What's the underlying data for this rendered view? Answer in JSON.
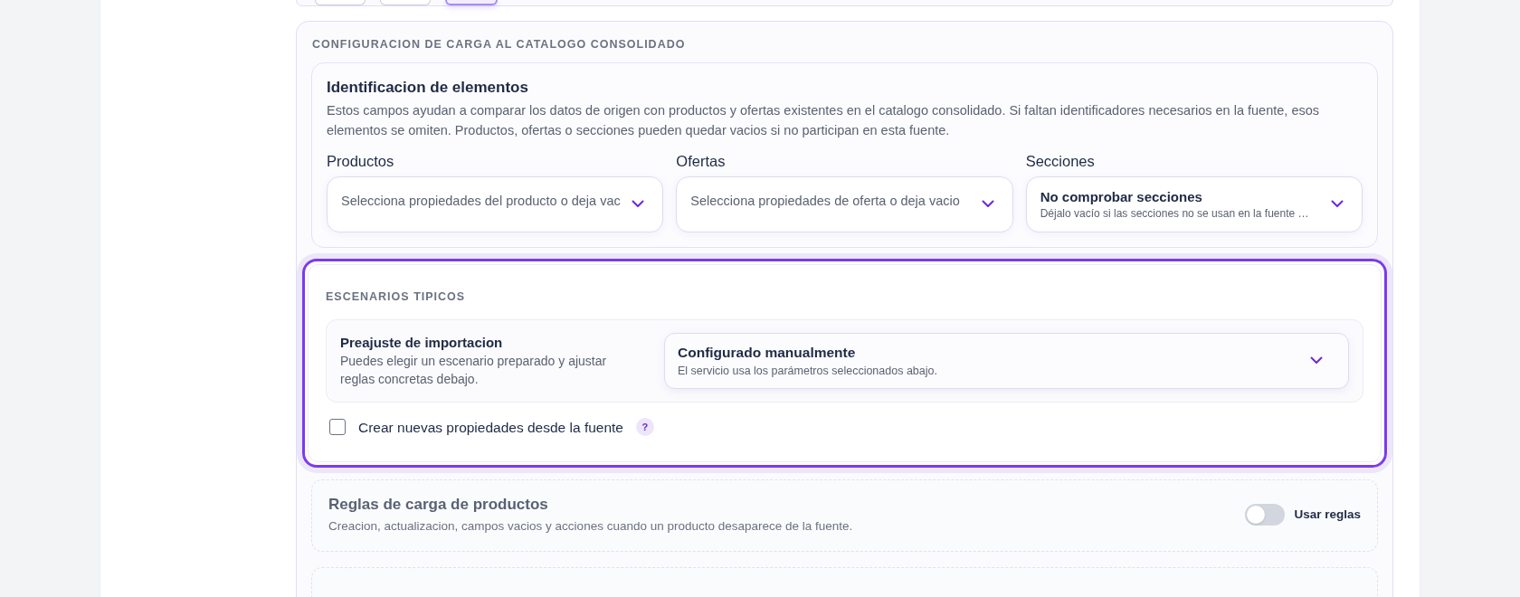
{
  "top_card": {
    "buttons": [
      {
        "selected": false
      },
      {
        "selected": false
      },
      {
        "selected": true
      }
    ]
  },
  "catalog_section": {
    "heading": "CONFIGURACION DE CARGA AL CATALOGO CONSOLIDADO",
    "identification": {
      "title": "Identificacion de elementos",
      "description": "Estos campos ayudan a comparar los datos de origen con productos y ofertas existentes en el catalogo consolidado. Si faltan identificadores necesarios en la fuente, esos elementos se omiten. Productos, ofertas o secciones pueden quedar vacios si no participan en esta fuente.",
      "fields": [
        {
          "label": "Productos",
          "placeholder": "Selecciona propiedades del producto o deja vac"
        },
        {
          "label": "Ofertas",
          "placeholder": "Selecciona propiedades de oferta o deja vacio"
        },
        {
          "label": "Secciones",
          "value": "No comprobar secciones",
          "hint": "Déjalo vacío si las secciones no se usan en la fuente …"
        }
      ]
    },
    "scenarios": {
      "heading": "ESCENARIOS TIPICOS",
      "preset_title": "Preajuste de importacion",
      "preset_description": "Puedes elegir un escenario preparado y ajustar reglas concretas debajo.",
      "preset_value": "Configurado manualmente",
      "preset_hint": "El servicio usa los parámetros seleccionados abajo.",
      "checkbox": {
        "label": "Crear nuevas propiedades desde la fuente",
        "checked": false,
        "help": "?"
      }
    },
    "rules": [
      {
        "title": "Reglas de carga de productos",
        "description": "Creacion, actualizacion, campos vacios y acciones cuando un producto desaparece de la fuente.",
        "toggle_label": "Usar reglas",
        "on": false
      }
    ]
  }
}
